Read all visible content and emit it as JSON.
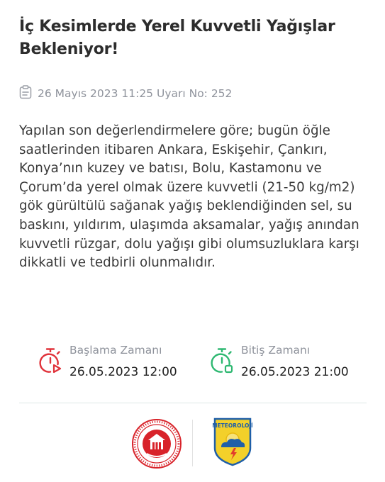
{
  "alert": {
    "title": "İç Kesimlerde Yerel Kuvvetli Yağışlar Bekleniyor!",
    "meta": "26 Mayıs 2023 11:25 Uyarı No: 252",
    "body": "Yapılan son değerlendirmelere göre; bugün öğle saatlerinden itibaren Ankara, Eskişehir, Çankırı, Konya’nın kuzey ve batısı, Bolu, Kastamonu ve Çorum’da yerel olmak üzere kuvvetli (21-50 kg/m2) gök gürültülü sağanak yağış beklendiğinden sel, su baskını, yıldırım, ulaşımda aksamalar, yağış anından kuvvetli rüzgar, dolu yağışı gibi olumsuzluklara karşı dikkatli ve tedbirli olunmalıdır."
  },
  "timing": {
    "start_label": "Başlama Zamanı",
    "start_value": "26.05.2023 12:00",
    "end_label": "Bitiş Zamanı",
    "end_value": "26.05.2023 21:00"
  },
  "logos": {
    "met_text": "METEOROLOJİ"
  },
  "icons": {
    "meta": "clipboard-icon",
    "start": "stopwatch-play-icon",
    "end": "stopwatch-stop-icon"
  },
  "colors": {
    "start_icon": "#e0323a",
    "end_icon": "#2fb872",
    "muted_text": "#8f939c",
    "afad_red": "#d8232a",
    "met_yellow": "#f3d02a",
    "met_blue": "#1f5fa8"
  }
}
